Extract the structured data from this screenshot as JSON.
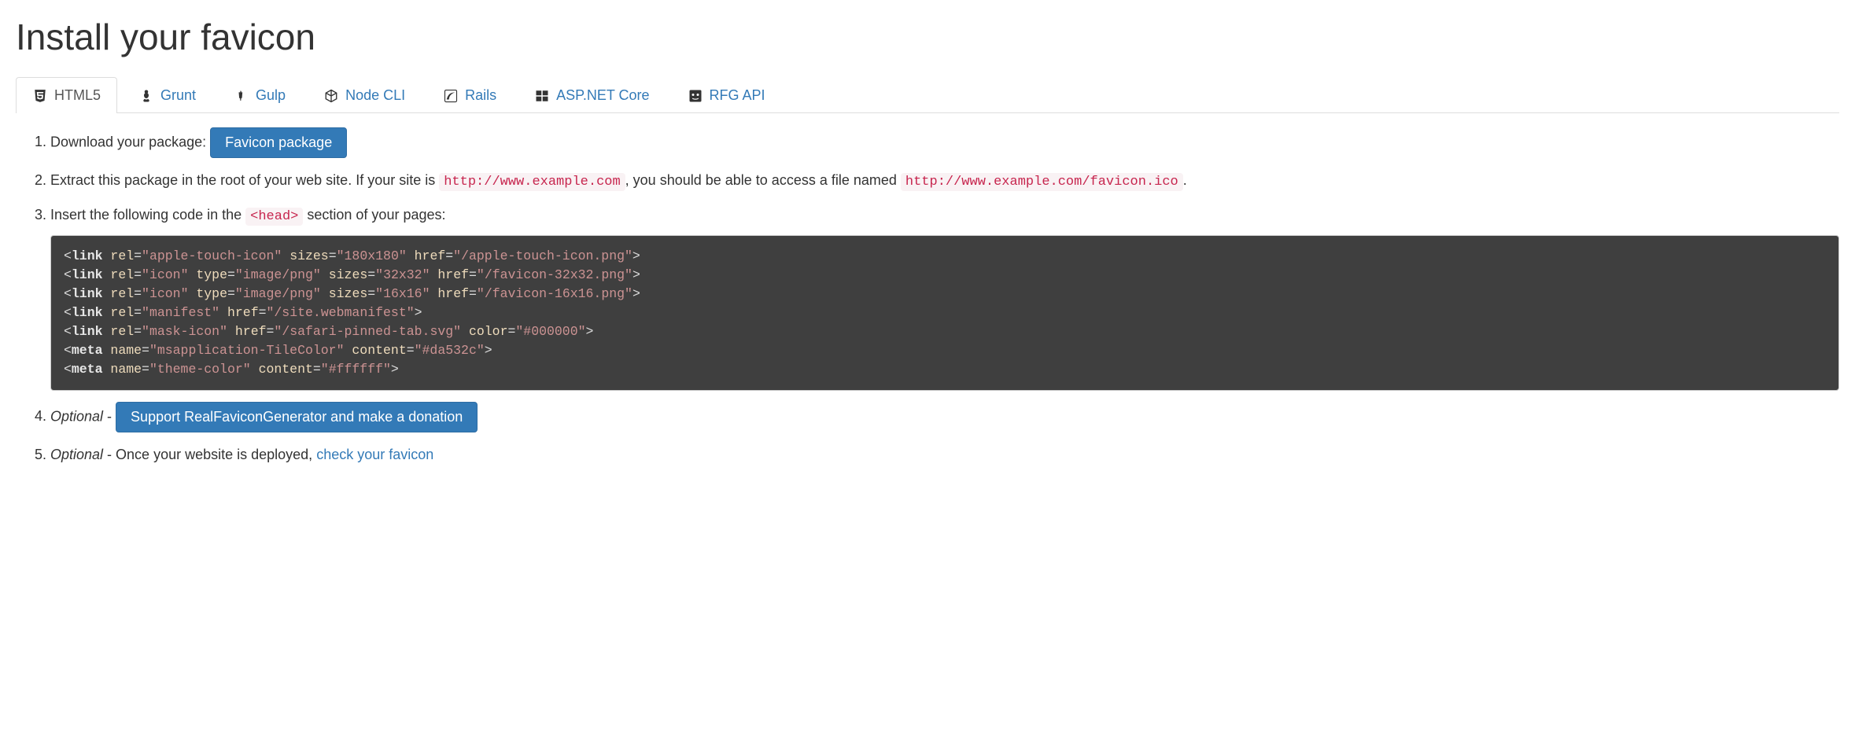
{
  "page_title": "Install your favicon",
  "tabs": [
    {
      "label": "HTML5"
    },
    {
      "label": "Grunt"
    },
    {
      "label": "Gulp"
    },
    {
      "label": "Node CLI"
    },
    {
      "label": "Rails"
    },
    {
      "label": "ASP.NET Core"
    },
    {
      "label": "RFG API"
    }
  ],
  "steps": {
    "s1": {
      "text": "Download your package: ",
      "button": "Favicon package"
    },
    "s2": {
      "prefix": "Extract this package in the root of your web site. If your site is ",
      "code1": "http://www.example.com",
      "mid": ", you should be able to access a file named ",
      "code2": "http://www.example.com/favicon.ico",
      "suffix": "."
    },
    "s3": {
      "prefix": "Insert the following code in the ",
      "code": "<head>",
      "suffix": " section of your pages:"
    },
    "s4": {
      "optional": "Optional",
      "dash": " - ",
      "button": "Support RealFaviconGenerator and make a donation"
    },
    "s5": {
      "optional": "Optional",
      "dash": " - ",
      "text": "Once your website is deployed, ",
      "link": "check your favicon"
    }
  },
  "code": {
    "l1": {
      "tag": "link",
      "a1": "rel",
      "v1": "apple-touch-icon",
      "a2": "sizes",
      "v2": "180x180",
      "a3": "href",
      "v3": "/apple-touch-icon.png"
    },
    "l2": {
      "tag": "link",
      "a1": "rel",
      "v1": "icon",
      "a2": "type",
      "v2": "image/png",
      "a3": "sizes",
      "v3": "32x32",
      "a4": "href",
      "v4": "/favicon-32x32.png"
    },
    "l3": {
      "tag": "link",
      "a1": "rel",
      "v1": "icon",
      "a2": "type",
      "v2": "image/png",
      "a3": "sizes",
      "v3": "16x16",
      "a4": "href",
      "v4": "/favicon-16x16.png"
    },
    "l4": {
      "tag": "link",
      "a1": "rel",
      "v1": "manifest",
      "a2": "href",
      "v2": "/site.webmanifest"
    },
    "l5": {
      "tag": "link",
      "a1": "rel",
      "v1": "mask-icon",
      "a2": "href",
      "v2": "/safari-pinned-tab.svg",
      "a3": "color",
      "v3": "#000000"
    },
    "l6": {
      "tag": "meta",
      "a1": "name",
      "v1": "msapplication-TileColor",
      "a2": "content",
      "v2": "#da532c"
    },
    "l7": {
      "tag": "meta",
      "a1": "name",
      "v1": "theme-color",
      "a2": "content",
      "v2": "#ffffff"
    }
  }
}
